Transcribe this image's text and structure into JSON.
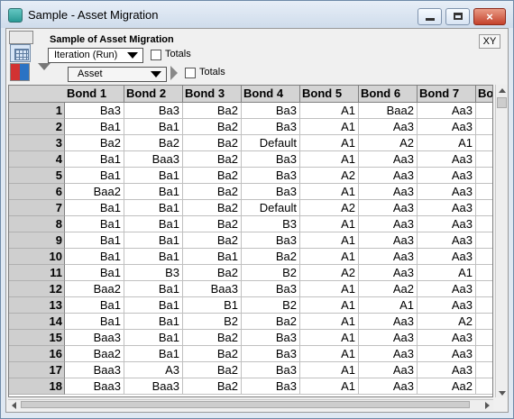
{
  "window": {
    "title": "Sample - Asset Migration",
    "close_label": "×"
  },
  "toolbar": {
    "title": "Sample of Asset Migration",
    "iteration_select": "Iteration (Run)",
    "asset_select": "Asset",
    "totals1": "Totals",
    "totals2": "Totals",
    "xy_button": "XY"
  },
  "table": {
    "columns": [
      "Bond 1",
      "Bond 2",
      "Bond 3",
      "Bond 4",
      "Bond 5",
      "Bond 6",
      "Bond 7",
      "Bo"
    ],
    "rows": [
      {
        "n": "1",
        "cells": [
          "Ba3",
          "Ba3",
          "Ba2",
          "Ba3",
          "A1",
          "Baa2",
          "Aa3"
        ]
      },
      {
        "n": "2",
        "cells": [
          "Ba1",
          "Ba1",
          "Ba2",
          "Ba3",
          "A1",
          "Aa3",
          "Aa3"
        ]
      },
      {
        "n": "3",
        "cells": [
          "Ba2",
          "Ba2",
          "Ba2",
          "Default",
          "A1",
          "A2",
          "A1"
        ]
      },
      {
        "n": "4",
        "cells": [
          "Ba1",
          "Baa3",
          "Ba2",
          "Ba3",
          "A1",
          "Aa3",
          "Aa3"
        ]
      },
      {
        "n": "5",
        "cells": [
          "Ba1",
          "Ba1",
          "Ba2",
          "Ba3",
          "A2",
          "Aa3",
          "Aa3"
        ]
      },
      {
        "n": "6",
        "cells": [
          "Baa2",
          "Ba1",
          "Ba2",
          "Ba3",
          "A1",
          "Aa3",
          "Aa3"
        ]
      },
      {
        "n": "7",
        "cells": [
          "Ba1",
          "Ba1",
          "Ba2",
          "Default",
          "A2",
          "Aa3",
          "Aa3"
        ]
      },
      {
        "n": "8",
        "cells": [
          "Ba1",
          "Ba1",
          "Ba2",
          "B3",
          "A1",
          "Aa3",
          "Aa3"
        ]
      },
      {
        "n": "9",
        "cells": [
          "Ba1",
          "Ba1",
          "Ba2",
          "Ba3",
          "A1",
          "Aa3",
          "Aa3"
        ]
      },
      {
        "n": "10",
        "cells": [
          "Ba1",
          "Ba1",
          "Ba1",
          "Ba2",
          "A1",
          "Aa3",
          "Aa3"
        ]
      },
      {
        "n": "11",
        "cells": [
          "Ba1",
          "B3",
          "Ba2",
          "B2",
          "A2",
          "Aa3",
          "A1"
        ]
      },
      {
        "n": "12",
        "cells": [
          "Baa2",
          "Ba1",
          "Baa3",
          "Ba3",
          "A1",
          "Aa2",
          "Aa3"
        ]
      },
      {
        "n": "13",
        "cells": [
          "Ba1",
          "Ba1",
          "B1",
          "B2",
          "A1",
          "A1",
          "Aa3"
        ]
      },
      {
        "n": "14",
        "cells": [
          "Ba1",
          "Ba1",
          "B2",
          "Ba2",
          "A1",
          "Aa3",
          "A2"
        ]
      },
      {
        "n": "15",
        "cells": [
          "Baa3",
          "Ba1",
          "Ba2",
          "Ba3",
          "A1",
          "Aa3",
          "Aa3"
        ]
      },
      {
        "n": "16",
        "cells": [
          "Baa2",
          "Ba1",
          "Ba2",
          "Ba3",
          "A1",
          "Aa3",
          "Aa3"
        ]
      },
      {
        "n": "17",
        "cells": [
          "Baa3",
          "A3",
          "Ba2",
          "Ba3",
          "A1",
          "Aa3",
          "Aa3"
        ]
      },
      {
        "n": "18",
        "cells": [
          "Baa3",
          "Baa3",
          "Ba2",
          "Ba3",
          "A1",
          "Aa3",
          "Aa2"
        ]
      }
    ]
  }
}
